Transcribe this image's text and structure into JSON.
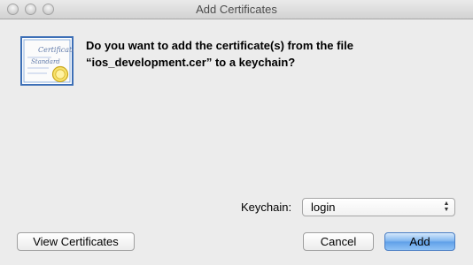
{
  "window": {
    "title": "Add Certificates"
  },
  "icon": {
    "name": "certificate-icon",
    "text_line1": "Certificate",
    "text_line2": "Standard"
  },
  "dialog": {
    "question_line1": "Do you want to add the certificate(s) from the file",
    "question_line2": "“ios_development.cer” to a keychain?"
  },
  "keychain": {
    "label": "Keychain:",
    "selected": "login"
  },
  "buttons": {
    "view_certificates": "View Certificates",
    "cancel": "Cancel",
    "add": "Add"
  },
  "colors": {
    "default_button": "#6aa8ec",
    "certificate_border": "#3d6fb6"
  }
}
